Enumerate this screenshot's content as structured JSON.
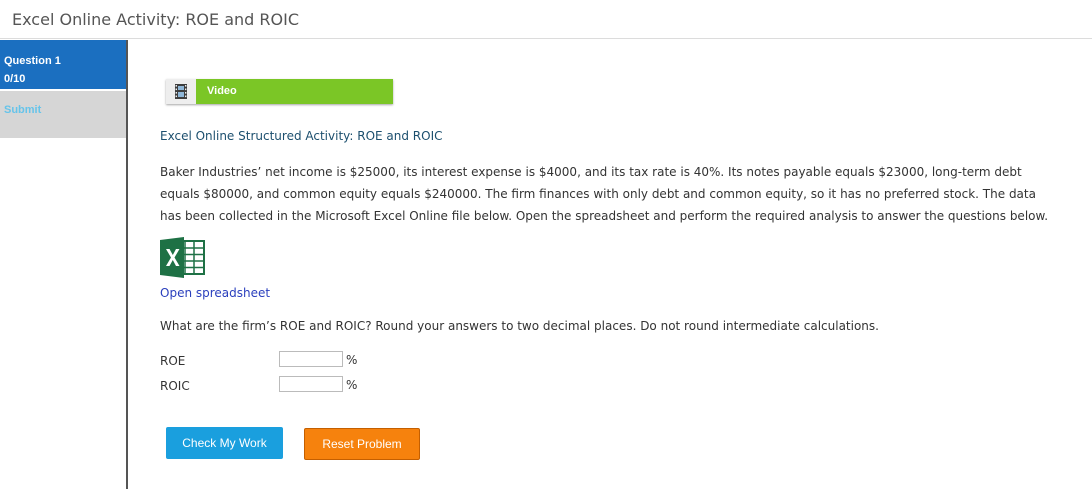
{
  "header": {
    "title": "Excel Online Activity: ROE and ROIC"
  },
  "sidebar": {
    "question_label": "Question 1",
    "score": "0/10",
    "submit_label": "Submit"
  },
  "video": {
    "label": "Video",
    "icon": "film-icon"
  },
  "main": {
    "heading": "Excel Online Structured Activity: ROE and ROIC",
    "paragraph": "Baker Industries’ net income is $25000, its interest expense is $4000, and its tax rate is 40%. Its notes payable equals $23000, long-term debt equals $80000, and common equity equals $240000. The firm finances with only debt and common equity, so it has no preferred stock. The data has been collected in the Microsoft Excel Online file below. Open the spreadsheet and perform the required analysis to answer the questions below.",
    "excel_icon": "excel-icon",
    "open_link": "Open spreadsheet",
    "question": "What are the firm’s ROE and ROIC? Round your answers to two decimal places. Do not round intermediate calculations.",
    "fields": [
      {
        "label": "ROE",
        "value": "",
        "unit": "%"
      },
      {
        "label": "ROIC",
        "value": "",
        "unit": "%"
      }
    ]
  },
  "buttons": {
    "check": "Check My Work",
    "reset": "Reset Problem"
  },
  "colors": {
    "sidebar_active": "#1b6fc0",
    "video_green": "#7bc626",
    "check_blue": "#1a9fde",
    "reset_orange": "#f6820d",
    "excel_green": "#1e7145"
  }
}
